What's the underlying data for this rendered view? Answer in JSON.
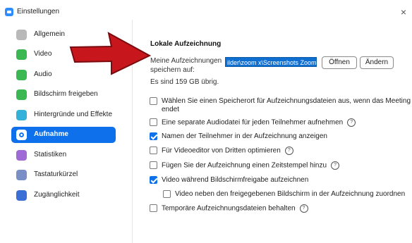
{
  "window": {
    "title": "Einstellungen",
    "close_glyph": "×"
  },
  "sidebar": {
    "items": [
      {
        "label": "Allgemein",
        "icon": "gear-icon",
        "active": false
      },
      {
        "label": "Video",
        "icon": "video-camera-icon",
        "active": false
      },
      {
        "label": "Audio",
        "icon": "headphones-icon",
        "active": false
      },
      {
        "label": "Bildschirm freigeben",
        "icon": "screen-share-icon",
        "active": false
      },
      {
        "label": "Hintergründe und Effekte",
        "icon": "person-background-icon",
        "active": false
      },
      {
        "label": "Aufnahme",
        "icon": "record-icon",
        "active": true
      },
      {
        "label": "Statistiken",
        "icon": "bar-chart-icon",
        "active": false
      },
      {
        "label": "Tastaturkürzel",
        "icon": "keyboard-icon",
        "active": false
      },
      {
        "label": "Zugänglichkeit",
        "icon": "accessibility-icon",
        "active": false
      }
    ]
  },
  "recording": {
    "section_title": "Lokale Aufzeichnung",
    "folder_label_line1": "Meine Aufzeichnungen",
    "folder_label_line2": "speichern auf:",
    "folder_path": "ilder\\zoom x\\Screenshots Zoom",
    "open_button": "Öffnen",
    "change_button": "Ändern",
    "free_space": "Es sind 159 GB übrig."
  },
  "options": [
    {
      "line1": "Wählen Sie einen Speicherort für Aufzeichnungsdateien aus, wenn das Meeting",
      "line2": "endet",
      "checked": false,
      "help": false
    },
    {
      "line1": "Eine separate Audiodatei für jeden Teilnehmer aufnehmen",
      "checked": false,
      "help": true
    },
    {
      "line1": "Namen der Teilnehmer in der Aufzeichnung anzeigen",
      "checked": true,
      "help": false
    },
    {
      "line1": "Für Videoeditor von Dritten optimieren",
      "checked": false,
      "help": true
    },
    {
      "line1": "Fügen Sie der Aufzeichnung einen Zeitstempel hinzu",
      "checked": false,
      "help": true
    },
    {
      "line1": "Video während Bildschirmfreigabe aufzeichnen",
      "checked": true,
      "help": false
    },
    {
      "line1": "Video neben den freigegebenen Bildschirm in der Aufzeichnung zuordnen",
      "checked": false,
      "help": false
    },
    {
      "line1": "Temporäre Aufzeichnungsdateien behalten",
      "checked": false,
      "help": true
    }
  ],
  "help_glyph": "?",
  "colors": {
    "accent": "#0e71eb",
    "arrow": "#c8161d"
  }
}
